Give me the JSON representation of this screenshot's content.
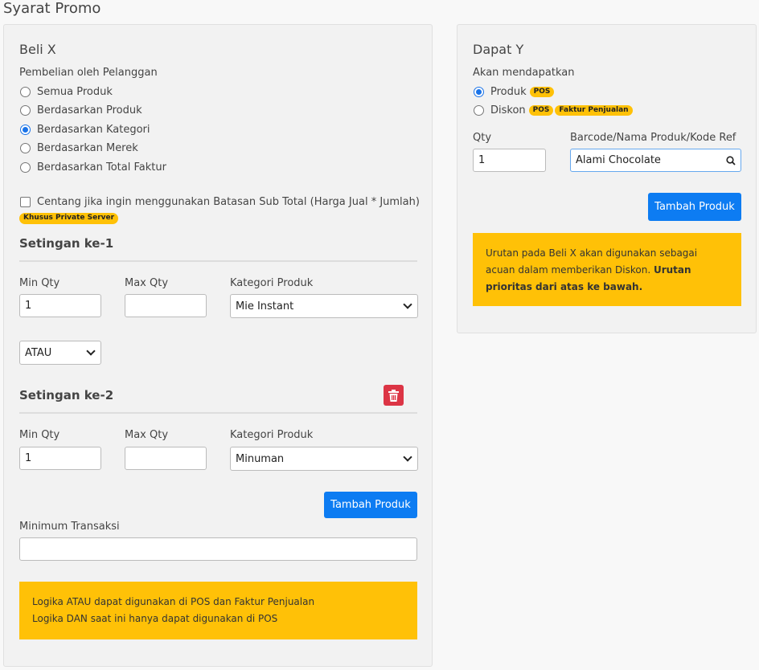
{
  "page_title": "Syarat Promo",
  "beli_x": {
    "title": "Beli X",
    "pembelian_label": "Pembelian oleh Pelanggan",
    "options": [
      {
        "label": "Semua Produk",
        "checked": false
      },
      {
        "label": "Berdasarkan Produk",
        "checked": false
      },
      {
        "label": "Berdasarkan Kategori",
        "checked": true
      },
      {
        "label": "Berdasarkan Merek",
        "checked": false
      },
      {
        "label": "Berdasarkan Total Faktur",
        "checked": false
      }
    ],
    "subtotal_checkbox_label": "Centang jika ingin menggunakan Batasan Sub Total (Harga Jual * Jumlah)",
    "private_server_badge": "Khusus Private Server",
    "setting1": {
      "title": "Setingan ke-1",
      "min_qty_label": "Min Qty",
      "min_qty_value": "1",
      "max_qty_label": "Max Qty",
      "max_qty_value": "",
      "kategori_label": "Kategori Produk",
      "kategori_value": "Mie Instant"
    },
    "logic_select_value": "ATAU",
    "setting2": {
      "title": "Setingan ke-2",
      "min_qty_label": "Min Qty",
      "min_qty_value": "1",
      "max_qty_label": "Max Qty",
      "max_qty_value": "",
      "kategori_label": "Kategori Produk",
      "kategori_value": "Minuman"
    },
    "tambah_produk_label": "Tambah Produk",
    "minimum_transaksi_label": "Minimum Transaksi",
    "minimum_transaksi_value": "",
    "alert_line1": "Logika ATAU dapat digunakan di POS dan Faktur Penjualan",
    "alert_line2": "Logika DAN saat ini hanya dapat digunakan di POS"
  },
  "dapat_y": {
    "title": "Dapat Y",
    "akan_label": "Akan mendapatkan",
    "produk_label": "Produk",
    "produk_badge": "POS",
    "diskon_label": "Diskon",
    "diskon_badge1": "POS",
    "diskon_badge2": "Faktur Penjualan",
    "qty_label": "Qty",
    "qty_value": "1",
    "barcode_label": "Barcode/Nama Produk/Kode Ref",
    "barcode_value": "Alami Chocolate",
    "tambah_produk_label": "Tambah Produk",
    "alert_text": "Urutan pada Beli X akan digunakan sebagai acuan dalam memberikan Diskon. ",
    "alert_bold": "Urutan prioritas dari atas ke bawah."
  },
  "colors": {
    "primary": "#0d7cf2",
    "warning": "#ffc107",
    "danger": "#dc3545"
  },
  "icons": [
    "search-icon",
    "trash-icon",
    "chevron-down-icon"
  ]
}
